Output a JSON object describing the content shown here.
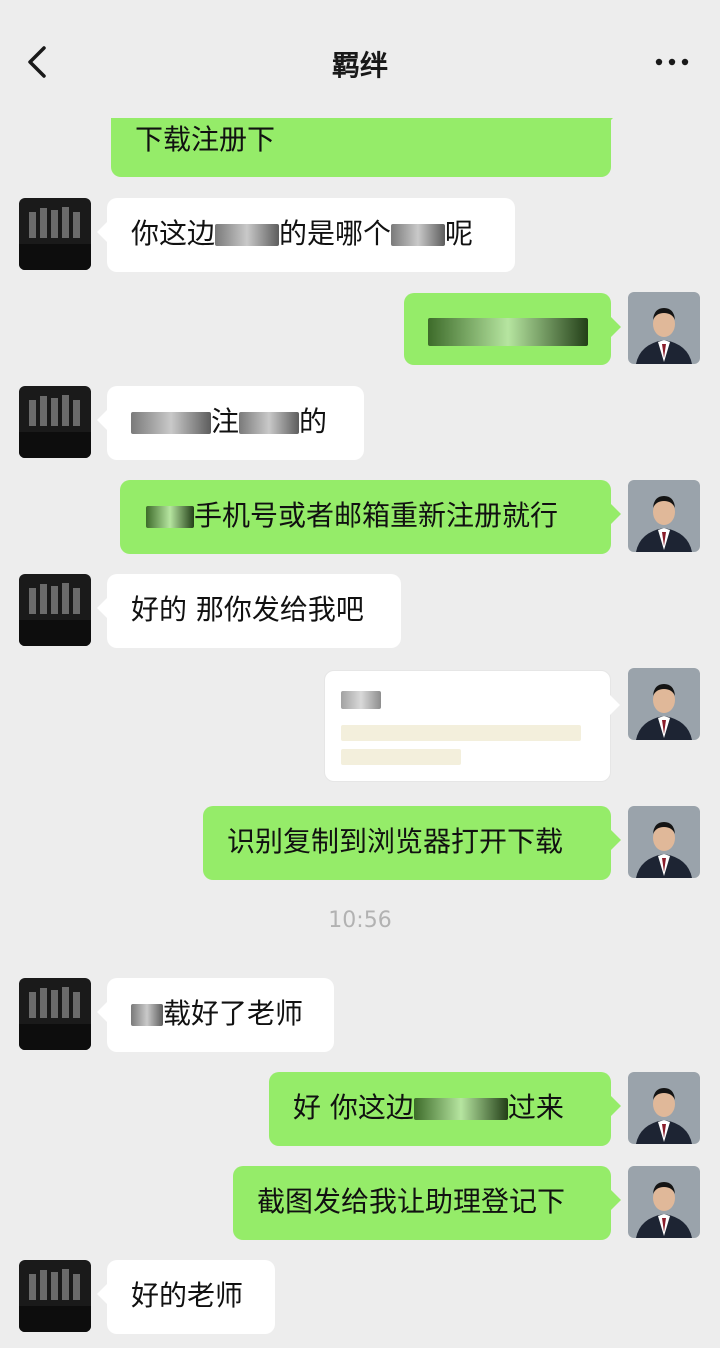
{
  "header": {
    "title": "羁绊",
    "back_icon": "chevron-left-icon",
    "more_icon": "more-dots-icon"
  },
  "messages": [
    {
      "side": "out",
      "text": "下载注册下"
    },
    {
      "side": "in",
      "text_a": "你这边",
      "text_b": "的是哪个",
      "text_c": "呢"
    },
    {
      "side": "out",
      "text": ""
    },
    {
      "side": "in",
      "text_a": "",
      "text_b": "注",
      "text_c": "的"
    },
    {
      "side": "out",
      "text": "手机号或者邮箱重新注册就行"
    },
    {
      "side": "in",
      "text": "好的 那你发给我吧"
    },
    {
      "side": "out",
      "type": "card"
    },
    {
      "side": "out",
      "text": "识别复制到浏览器打开下载"
    },
    {
      "side": "in",
      "text": "载好了老师"
    },
    {
      "side": "out",
      "text_a": "好 你这边",
      "text_b": "过来"
    },
    {
      "side": "out",
      "text": "截图发给我让助理登记下"
    },
    {
      "side": "in",
      "text": "好的老师"
    }
  ],
  "timestamp": "10:56",
  "colors": {
    "outgoing_bubble": "#95ec69",
    "incoming_bubble": "#ffffff",
    "background": "#ededed"
  }
}
